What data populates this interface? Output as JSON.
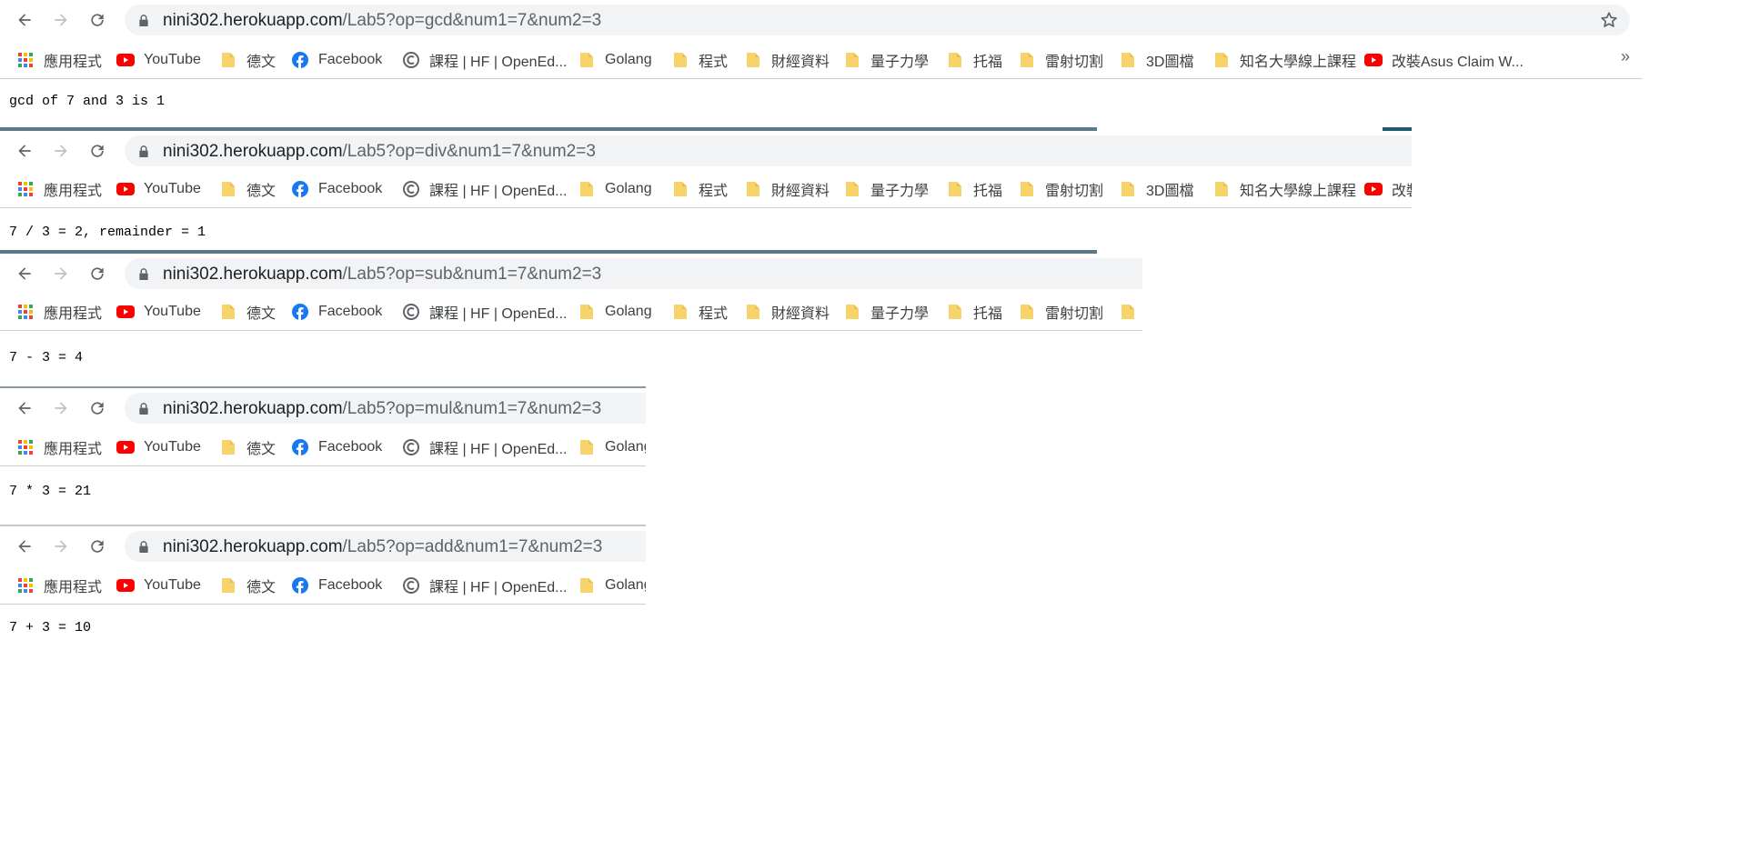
{
  "bookmarks": {
    "apps": "應用程式",
    "youtube": "YouTube",
    "german": "德文",
    "facebook": "Facebook",
    "edx": "課程 | HF | OpenEd...",
    "golang": "Golang",
    "program": "程式",
    "finance": "財經資料",
    "quantum": "量子力學",
    "toefl": "托福",
    "laser": "雷射切割",
    "model3d": "3D圖檔",
    "univ": "知名大學線上課程",
    "asus": "改裝Asus Claim W...",
    "more": "»"
  },
  "windows": [
    {
      "host": "nini302.herokuapp.com",
      "path": "/Lab5?op=gcd&num1=7&num2=3",
      "result": "gcd of 7 and 3 is 1"
    },
    {
      "host": "nini302.herokuapp.com",
      "path": "/Lab5?op=div&num1=7&num2=3",
      "result": "7 / 3 = 2, remainder = 1"
    },
    {
      "host": "nini302.herokuapp.com",
      "path": "/Lab5?op=sub&num1=7&num2=3",
      "result": "7 - 3 = 4"
    },
    {
      "host": "nini302.herokuapp.com",
      "path": "/Lab5?op=mul&num1=7&num2=3",
      "result": "7 * 3 = 21"
    },
    {
      "host": "nini302.herokuapp.com",
      "path": "/Lab5?op=add&num1=7&num2=3",
      "result": "7 + 3 = 10"
    }
  ],
  "partial": {
    "asus_cut": "改裝",
    "golang_cut": "Golang"
  },
  "colors": {
    "folder": "#f6d36b",
    "youtube": "#ff0000",
    "facebook": "#1877f2",
    "apps": "#4285f4"
  }
}
